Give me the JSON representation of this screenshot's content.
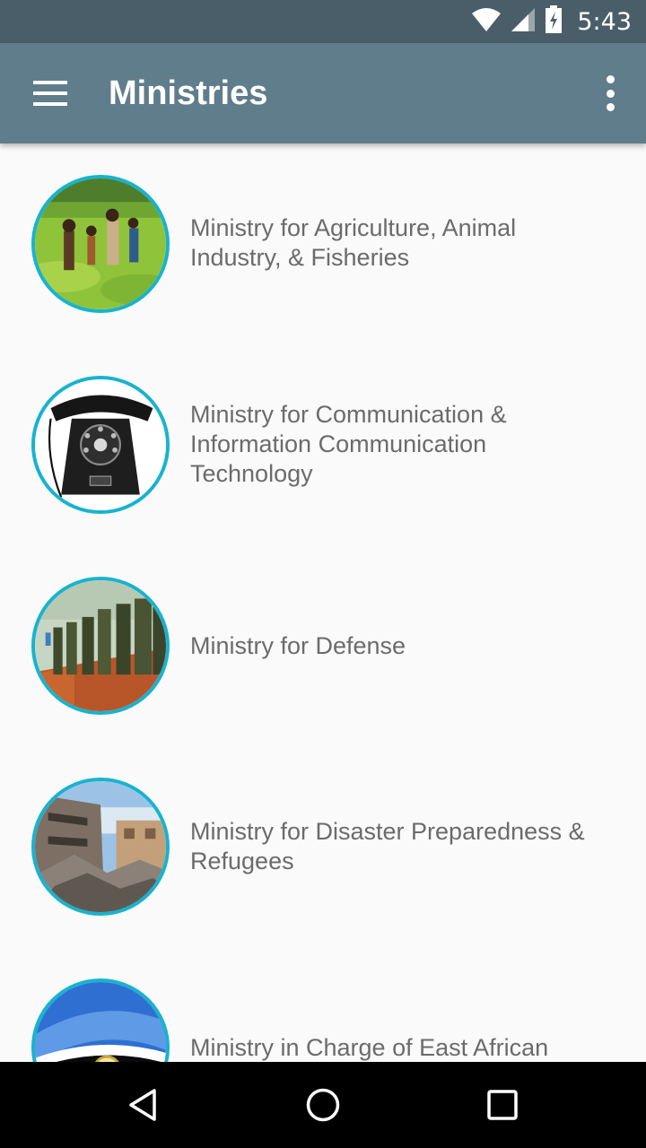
{
  "status_bar": {
    "time": "5:43",
    "icons": [
      "wifi-icon",
      "cell-signal-icon",
      "battery-charging-icon"
    ]
  },
  "app_bar": {
    "title": "Ministries",
    "menu_icon": "hamburger-menu-icon",
    "overflow_icon": "more-vert-icon"
  },
  "colors": {
    "status_bar": "#4a5e69",
    "app_bar": "#607d8b",
    "avatar_border": "#17b3cf",
    "item_text": "#6b6b6b",
    "background": "#fafafa"
  },
  "ministries": [
    {
      "label": "Ministry for Agriculture, Animal Industry, & Fisheries",
      "image": "farmers-in-tea-field"
    },
    {
      "label": "Ministry for Communication & Information Communication Technology",
      "image": "rotary-telephone"
    },
    {
      "label": "Ministry for Defense",
      "image": "soldiers-in-formation"
    },
    {
      "label": "Ministry for Disaster Preparedness & Refugees",
      "image": "collapsed-building"
    },
    {
      "label": "Ministry in Charge of East African Affairs",
      "image": "east-african-community-flag"
    }
  ],
  "nav_bar": {
    "icons": [
      "back-icon",
      "home-icon",
      "recents-icon"
    ]
  }
}
